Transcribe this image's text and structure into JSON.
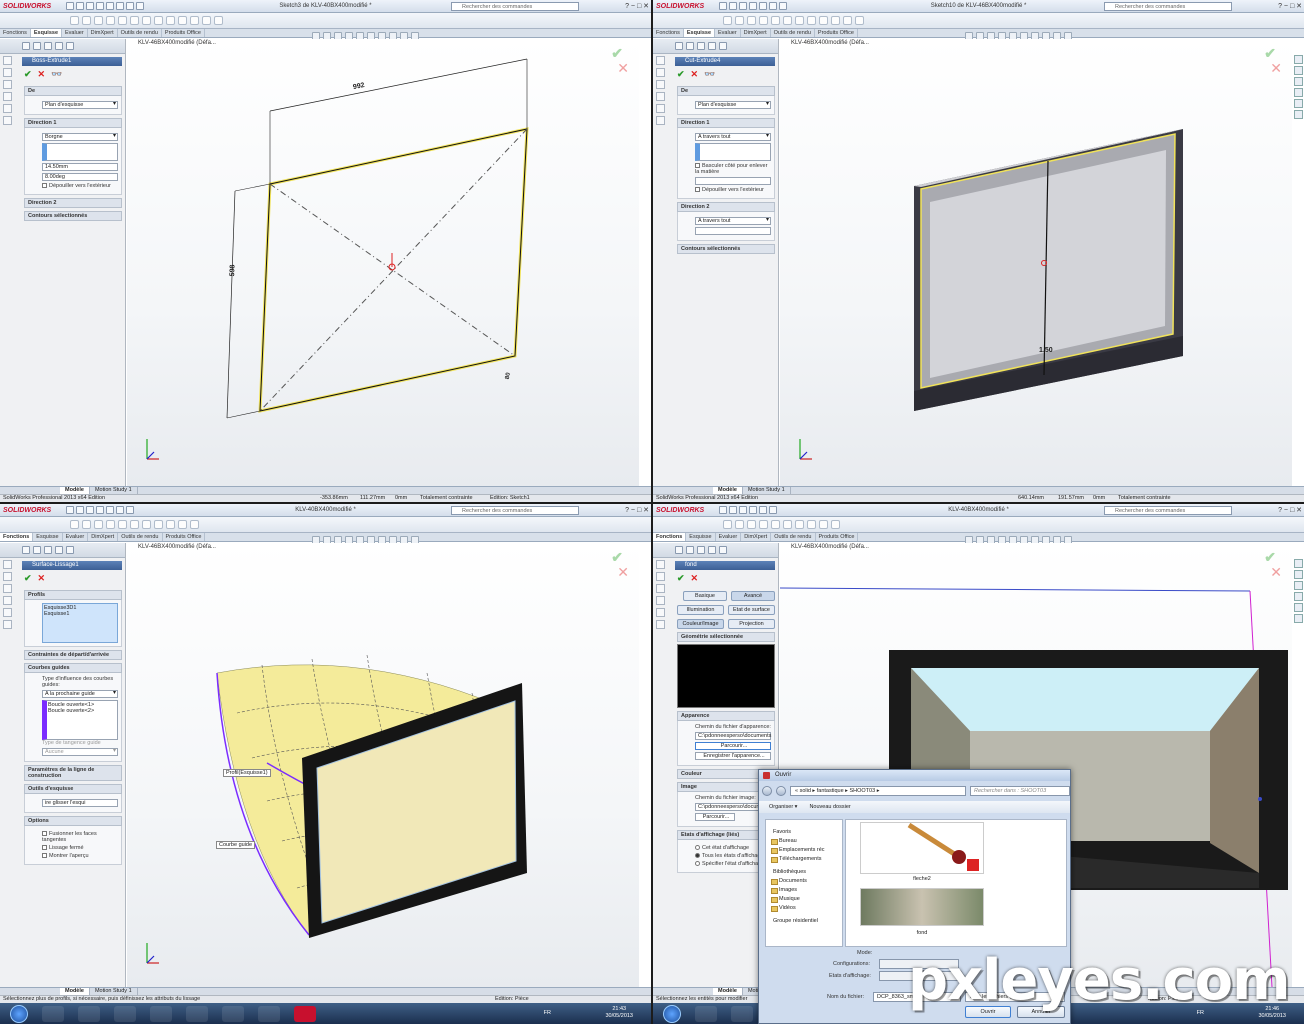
{
  "app": {
    "logo": "SOLIDWORKS",
    "search_placeholder": "Rechercher des commandes",
    "version": "SolidWorks Professional 2013 x64 Edition"
  },
  "q1": {
    "title": "Sketch3 de KLV-40BX400modifié *",
    "tabs": [
      "Fonctions",
      "Esquisse",
      "Evaluer",
      "DimXpert",
      "Outils de rendu",
      "Produits Office"
    ],
    "feature_tree": "KLV-46BX400modifié (Défa...",
    "feature": "Boss-Extrude1",
    "sec_de": "De",
    "de_value": "Plan d'esquisse",
    "sec_dir1": "Direction 1",
    "dir1_type": "Borgne",
    "depth": "14.50mm",
    "draft": "8.00deg",
    "draft_out": "Dépouiller vers l'extérieur",
    "sec_dir2": "Direction 2",
    "sec_contours": "Contours sélectionnés",
    "dim_top": "992",
    "dim_left": "598",
    "dim_corner": "80",
    "bottom_tabs": [
      "Modèle",
      "Motion Study 1"
    ],
    "status": "SolidWorks Professional 2013 x64 Edition",
    "coord_x": "-353.86mm",
    "coord_y": "111.27mm",
    "coord_z": "0mm",
    "constr": "Totalement contrainte",
    "edit": "Edition: Sketch1"
  },
  "q2": {
    "title": "Sketch10 de KLV-46BX400modifié *",
    "feature_tree": "KLV-46BX400modifié (Défa...",
    "feature": "Cut-Extrude4",
    "sec_de": "De",
    "de_value": "Plan d'esquisse",
    "sec_dir1": "Direction 1",
    "dir1_type": "A travers tout",
    "flip": "Basculer côté pour enlever la matière",
    "draft_out": "Dépouiller vers l'extérieur",
    "sec_dir2": "Direction 2",
    "dir2_type": "A travers tout",
    "sec_contours": "Contours sélectionnés",
    "dim": "1.50",
    "coord_x": "640.14mm",
    "coord_y": "191.57mm",
    "coord_z": "0mm",
    "constr": "Totalement contrainte"
  },
  "q3": {
    "title": "KLV-40BX400modifié *",
    "feature_tree": "KLV-46BX400modifié (Défa...",
    "feature": "Surface-Lissage1",
    "sec_profils": "Profils",
    "profil1": "Esquisse3D1",
    "profil2": "Esquisse1",
    "sec_contraintes": "Contraintes de départ/d'arrivée",
    "sec_courbes": "Courbes guides",
    "influence": "Type d'influence des courbes guides:",
    "influence_value": "A la prochaine guide",
    "guide1": "Boucle ouverte<1>",
    "guide2": "Boucle ouverte<2>",
    "tangence": "Type de tangence guide",
    "tangence_value": "Aucune",
    "sec_params": "Paramètres de la ligne de construction",
    "sec_outils": "Outils d'esquisse",
    "drag": "ire glisser l'esqui",
    "sec_options": "Options",
    "opt1": "Fusionner les faces tangentes",
    "opt2": "Lissage fermé",
    "opt3": "Montrer l'aperçu",
    "callout1": "Profil(Esquisse1)",
    "callout2": "Courbe guide",
    "status": "Sélectionnez plus de profils, si nécessaire, puis définissez les attributs du lissage",
    "edit": "Edition: Pièce",
    "time": "21:43",
    "date": "30/05/2013",
    "lang": "FR"
  },
  "q4": {
    "title": "KLV-40BX400modifié *",
    "feature_tree": "KLV-46BX400modifié (Défa...",
    "feature": "fond",
    "btn_basic": "Basique",
    "btn_adv": "Avancé",
    "tab_illum": "Illumination",
    "tab_etat": "Etat de surface",
    "tab_color": "Couleur/Image",
    "tab_proj": "Projection",
    "sec_geom": "Géométrie sélectionnée",
    "sec_app": "Apparence",
    "app_path_lbl": "Chemin du fichier d'apparence:",
    "app_path": "C:\\pdonneesperso\\documents",
    "browse": "Parcourir...",
    "save_app": "Enregistrer l'apparence...",
    "sec_color": "Couleur",
    "sec_image": "Image",
    "img_path_lbl": "Chemin du fichier image:",
    "img_path": "C:\\pdonneesperso\\docum",
    "sec_states": "Etats d'affichage (liés)",
    "state1": "Cet état d'affichage",
    "state2": "Tous les états d'affichage",
    "state3": "Spécifier l'état d'affichage",
    "status": "Sélectionnez les entités pour modifier",
    "edit": "Edition: Pièce",
    "time": "21:46",
    "date": "30/05/2013",
    "lang": "FR"
  },
  "dialog": {
    "title": "Ouvrir",
    "path": [
      "solid",
      "fantastique",
      "SHOOT03"
    ],
    "search": "Rechercher dans : SHOOT03",
    "organize": "Organiser ▾",
    "newfolder": "Nouveau dossier",
    "side": [
      "Favoris",
      "Bureau",
      "Emplacements réc",
      "Téléchargements",
      "Bibliothèques",
      "Documents",
      "Images",
      "Musique",
      "Vidéos",
      "Groupe résidentiel"
    ],
    "files": [
      "fleche2",
      "fond"
    ],
    "mode": "Mode:",
    "config": "Configurations:",
    "states": "Etats d'affichage:",
    "filename_lbl": "Nom du fichier:",
    "filename": "DCP_8363_sm",
    "filter": "Tous les fichiers (*.*)",
    "open": "Ouvrir",
    "cancel": "Annuler"
  },
  "watermark": "pxleyes.com",
  "colors": {
    "accent": "#3c5f95",
    "ok": "#2b9a2b",
    "cancel": "#dd2222",
    "preview_yellow": "#f4e79a"
  }
}
